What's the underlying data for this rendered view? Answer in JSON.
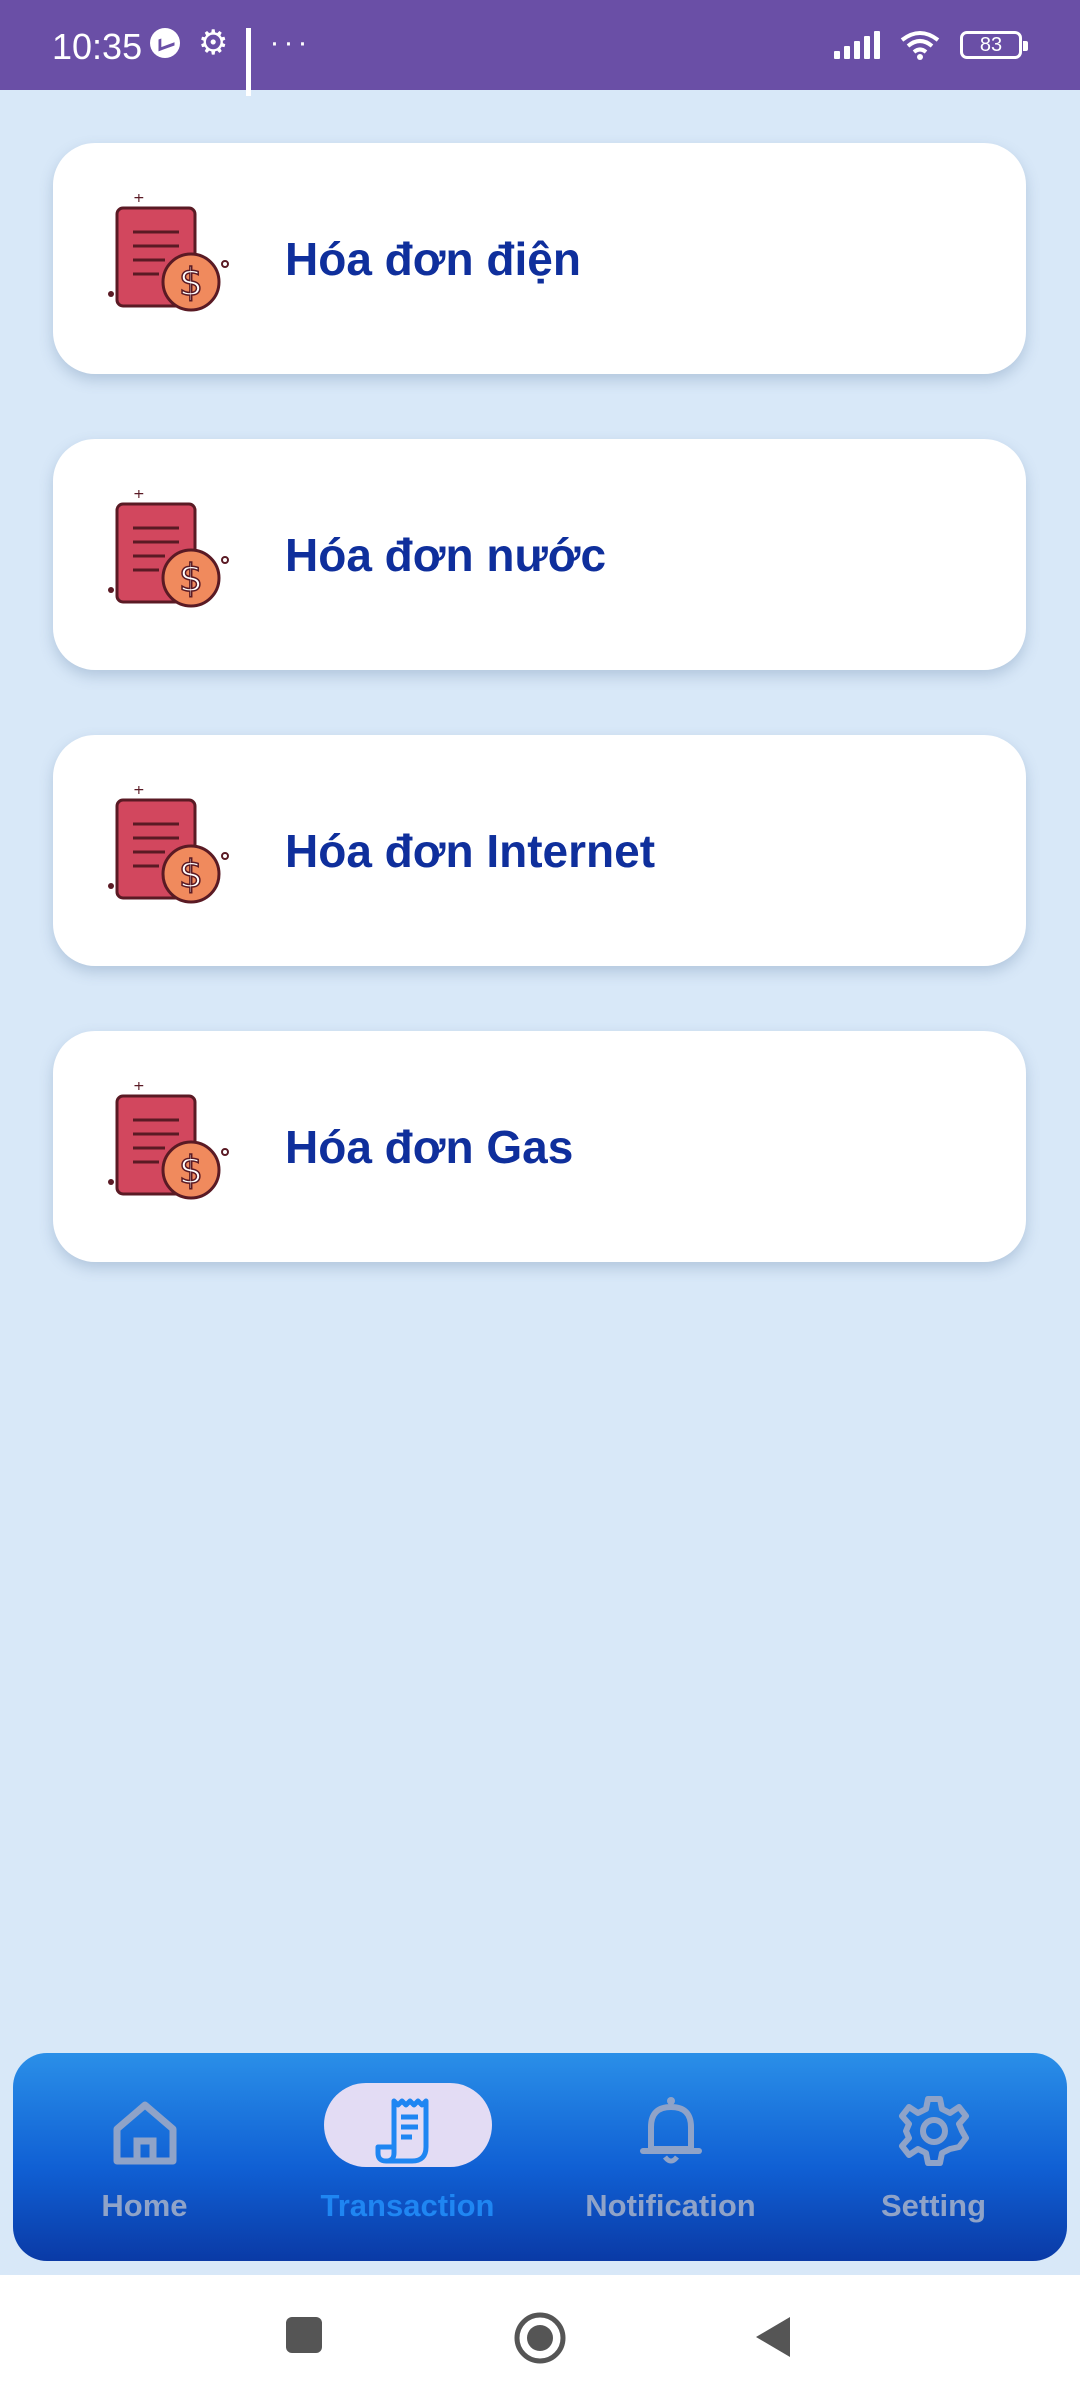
{
  "status_bar": {
    "time": "10:35",
    "battery": "83",
    "left_icons": [
      "messenger-icon",
      "gear-icon",
      "bars-icon",
      "more-dots-icon"
    ],
    "right_icons": [
      "signal-icon",
      "wifi-icon",
      "battery-icon"
    ]
  },
  "bills": [
    {
      "label": "Hóa đơn điện",
      "icon": "bill-dollar-icon"
    },
    {
      "label": "Hóa đơn nước",
      "icon": "bill-dollar-icon"
    },
    {
      "label": "Hóa đơn Internet",
      "icon": "bill-dollar-icon"
    },
    {
      "label": "Hóa đơn Gas",
      "icon": "bill-dollar-icon"
    }
  ],
  "bottom_nav": {
    "items": [
      {
        "label": "Home",
        "icon": "home-icon",
        "active": false
      },
      {
        "label": "Transaction",
        "icon": "receipt-icon",
        "active": true
      },
      {
        "label": "Notification",
        "icon": "bell-icon",
        "active": false
      },
      {
        "label": "Setting",
        "icon": "gear-icon",
        "active": false
      }
    ]
  },
  "colors": {
    "status_bar": "#6a4fa6",
    "background": "#d8e8f8",
    "card_text": "#0f2f9c",
    "nav_active": "#1f86f2",
    "nav_inactive": "#8fa3c8",
    "bill_icon_red": "#d2475e",
    "bill_icon_coin": "#f08a5d"
  },
  "system_nav": [
    "recent-apps-icon",
    "home-circle-icon",
    "back-triangle-icon"
  ]
}
